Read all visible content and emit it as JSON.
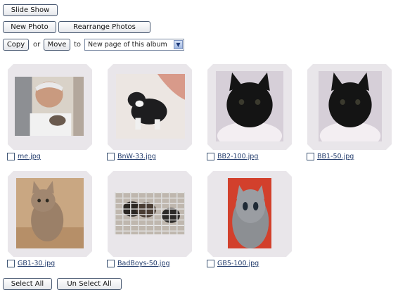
{
  "toolbar": {
    "slide_show": "Slide Show",
    "new_photo": "New Photo",
    "rearrange": "Rearrange Photos",
    "copy": "Copy",
    "or": "or",
    "move": "Move",
    "to": "to",
    "destination": "New page of this album"
  },
  "photos": [
    {
      "filename": "me.jpg",
      "subject": "man-with-kitten"
    },
    {
      "filename": "BnW-33.jpg",
      "subject": "black-white-kitten"
    },
    {
      "filename": "BB2-100.jpg",
      "subject": "black-kitten"
    },
    {
      "filename": "BB1-50.jpg",
      "subject": "black-kitten"
    },
    {
      "filename": "GB1-30.jpg",
      "subject": "tabby-kitten"
    },
    {
      "filename": "BadBoys-50.jpg",
      "subject": "kittens-in-cage"
    },
    {
      "filename": "GB5-100.jpg",
      "subject": "grey-tabby-kitten"
    }
  ],
  "footer": {
    "select_all": "Select All",
    "unselect_all": "Un Select All"
  }
}
